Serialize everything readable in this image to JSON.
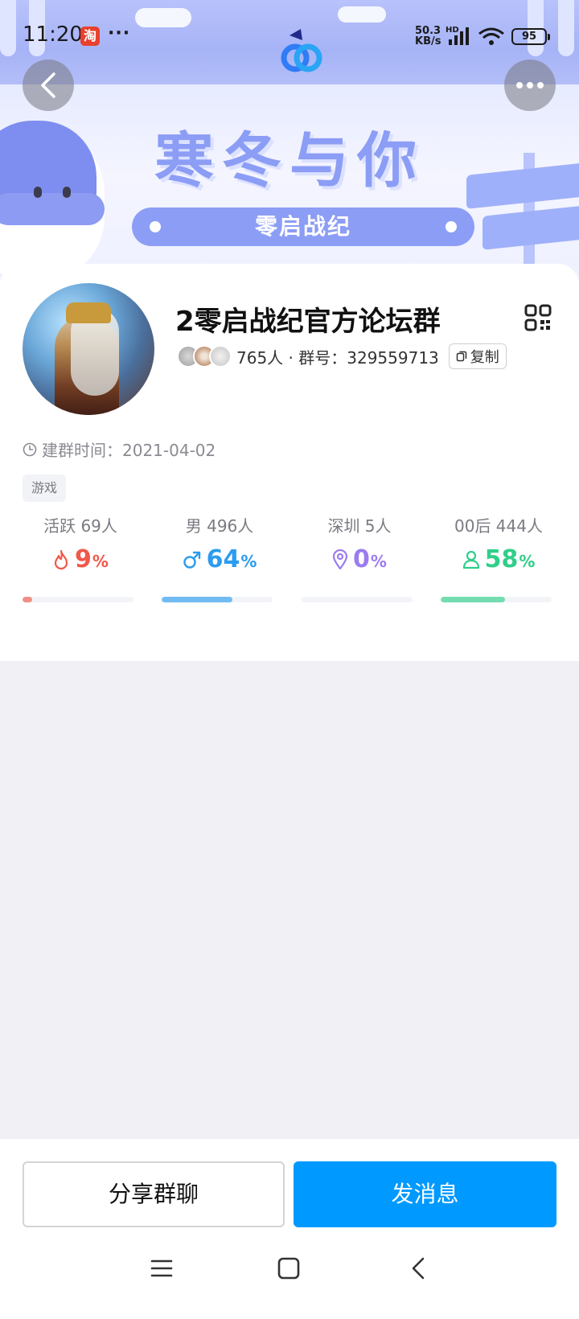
{
  "status_bar": {
    "time": "11:20",
    "taobao_glyph": "淘",
    "more": "···",
    "net_speed": "50.3",
    "net_unit": "KB/s",
    "hd": "HD",
    "battery": "95"
  },
  "banner": {
    "title": "寒冬与你",
    "subtitle": "零启战纪"
  },
  "group": {
    "name": "2零启战纪官方论坛群",
    "member_count_text": "765人 · 群号：329559713",
    "copy_label": "复制",
    "created_text": "建群时间：2021-04-02",
    "tag": "游戏"
  },
  "stats": [
    {
      "label": "活跃 69人",
      "value": "9",
      "unit": "%",
      "fraction": 0.09,
      "color": "#f0584a",
      "icon": "fire-icon"
    },
    {
      "label": "男 496人",
      "value": "64",
      "unit": "%",
      "fraction": 0.64,
      "color": "#2b9cf0",
      "icon": "male-icon"
    },
    {
      "label": "深圳 5人",
      "value": "0",
      "unit": "%",
      "fraction": 0.0,
      "color": "#9b7cf0",
      "icon": "location-pin-icon"
    },
    {
      "label": "00后 444人",
      "value": "58",
      "unit": "%",
      "fraction": 0.58,
      "color": "#2fcf8a",
      "icon": "person-icon"
    }
  ],
  "actions": {
    "share_label": "分享群聊",
    "send_label": "发消息"
  },
  "colors": {
    "primary": "#0099ff",
    "banner_accent": "#8c9df5"
  }
}
